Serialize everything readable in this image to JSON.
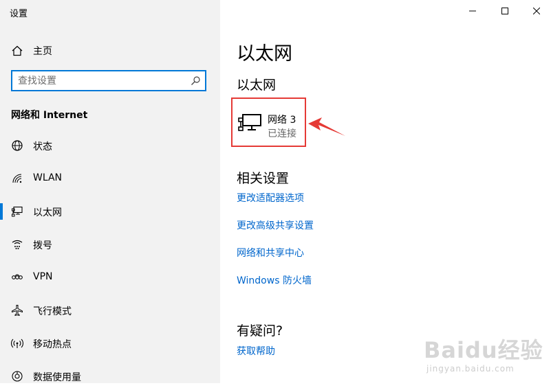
{
  "window": {
    "app_title": "设置",
    "controls": [
      "minimize",
      "maximize",
      "close"
    ]
  },
  "sidebar": {
    "home_label": "主页",
    "search": {
      "placeholder": "查找设置",
      "value": ""
    },
    "section_heading": "网络和 Internet",
    "items": [
      {
        "label": "状态",
        "icon": "status-icon",
        "active": false
      },
      {
        "label": "WLAN",
        "icon": "wifi-icon",
        "active": false
      },
      {
        "label": "以太网",
        "icon": "ethernet-icon",
        "active": true
      },
      {
        "label": "拨号",
        "icon": "dialup-icon",
        "active": false
      },
      {
        "label": "VPN",
        "icon": "vpn-icon",
        "active": false
      },
      {
        "label": "飞行模式",
        "icon": "airplane-icon",
        "active": false
      },
      {
        "label": "移动热点",
        "icon": "hotspot-icon",
        "active": false
      },
      {
        "label": "数据使用量",
        "icon": "data-usage-icon",
        "active": false
      }
    ]
  },
  "main": {
    "page_title": "以太网",
    "sub_title": "以太网",
    "network": {
      "name": "网络 3",
      "status": "已连接"
    },
    "related_title": "相关设置",
    "related_links": [
      "更改适配器选项",
      "更改高级共享设置",
      "网络和共享中心",
      "Windows 防火墙"
    ],
    "help_title": "有疑问?",
    "help_link": "获取帮助"
  },
  "watermark": {
    "brand": "Baidu经验",
    "url": "jingyan.baidu.com"
  },
  "colors": {
    "sidebar_bg": "#f2f2f2",
    "accent": "#0078d7",
    "link": "#0066cc",
    "highlight_box": "#e53935"
  }
}
